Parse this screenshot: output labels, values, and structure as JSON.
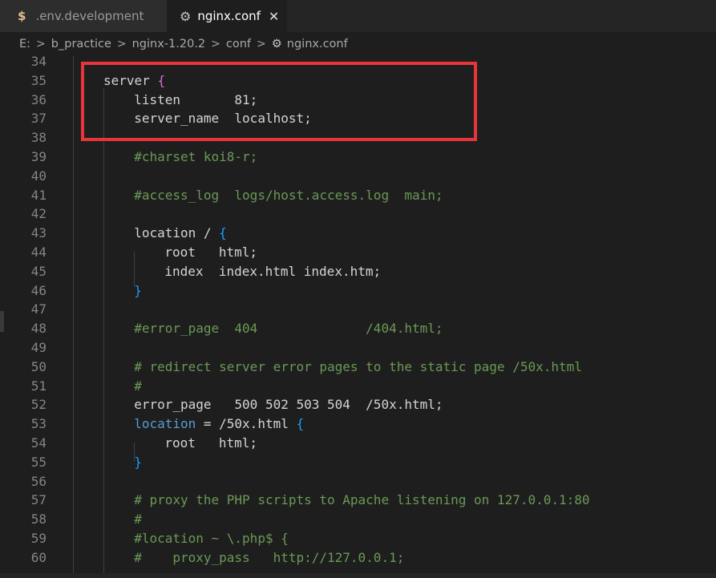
{
  "tabs": [
    {
      "label": ".env.development",
      "icon": "$",
      "active": false
    },
    {
      "label": "nginx.conf",
      "icon": "⚙",
      "active": true,
      "close": "✕"
    }
  ],
  "breadcrumb": [
    "E:",
    "b_practice",
    "nginx-1.20.2",
    "conf",
    "nginx.conf"
  ],
  "lines": [
    {
      "n": "34",
      "indent": 0,
      "tokens": []
    },
    {
      "n": "35",
      "indent": 1,
      "tokens": [
        {
          "t": "server ",
          "c": "text"
        },
        {
          "t": "{",
          "c": "bracket1"
        }
      ]
    },
    {
      "n": "36",
      "indent": 2,
      "tokens": [
        {
          "t": "listen       81;",
          "c": "text"
        }
      ]
    },
    {
      "n": "37",
      "indent": 2,
      "tokens": [
        {
          "t": "server_name  localhost;",
          "c": "text"
        }
      ]
    },
    {
      "n": "38",
      "indent": 0,
      "tokens": []
    },
    {
      "n": "39",
      "indent": 2,
      "tokens": [
        {
          "t": "#charset koi8-r;",
          "c": "comment"
        }
      ]
    },
    {
      "n": "40",
      "indent": 0,
      "tokens": []
    },
    {
      "n": "41",
      "indent": 2,
      "tokens": [
        {
          "t": "#access_log  logs/host.access.log  main;",
          "c": "comment"
        }
      ]
    },
    {
      "n": "42",
      "indent": 0,
      "tokens": []
    },
    {
      "n": "43",
      "indent": 2,
      "tokens": [
        {
          "t": "location / ",
          "c": "text"
        },
        {
          "t": "{",
          "c": "bracket2"
        }
      ]
    },
    {
      "n": "44",
      "indent": 3,
      "tokens": [
        {
          "t": "root   html;",
          "c": "text"
        }
      ]
    },
    {
      "n": "45",
      "indent": 3,
      "tokens": [
        {
          "t": "index  index.html index.htm;",
          "c": "text"
        }
      ]
    },
    {
      "n": "46",
      "indent": 2,
      "tokens": [
        {
          "t": "}",
          "c": "bracket2"
        }
      ]
    },
    {
      "n": "47",
      "indent": 0,
      "tokens": []
    },
    {
      "n": "48",
      "indent": 2,
      "tokens": [
        {
          "t": "#error_page  404              /404.html;",
          "c": "comment"
        }
      ]
    },
    {
      "n": "49",
      "indent": 0,
      "tokens": []
    },
    {
      "n": "50",
      "indent": 2,
      "tokens": [
        {
          "t": "# redirect server error pages to the static page /50x.html",
          "c": "comment"
        }
      ]
    },
    {
      "n": "51",
      "indent": 2,
      "tokens": [
        {
          "t": "#",
          "c": "comment"
        }
      ]
    },
    {
      "n": "52",
      "indent": 2,
      "tokens": [
        {
          "t": "error_page   500 502 503 504  /50x.html;",
          "c": "text"
        }
      ]
    },
    {
      "n": "53",
      "indent": 2,
      "tokens": [
        {
          "t": "location",
          "c": "keyword"
        },
        {
          "t": " = /50x.html ",
          "c": "text"
        },
        {
          "t": "{",
          "c": "bracket2"
        }
      ]
    },
    {
      "n": "54",
      "indent": 3,
      "tokens": [
        {
          "t": "root   html;",
          "c": "text"
        }
      ]
    },
    {
      "n": "55",
      "indent": 2,
      "tokens": [
        {
          "t": "}",
          "c": "bracket2"
        }
      ]
    },
    {
      "n": "56",
      "indent": 0,
      "tokens": []
    },
    {
      "n": "57",
      "indent": 2,
      "tokens": [
        {
          "t": "# proxy the PHP scripts to Apache listening on 127.0.0.1:80",
          "c": "comment"
        }
      ]
    },
    {
      "n": "58",
      "indent": 2,
      "tokens": [
        {
          "t": "#",
          "c": "comment"
        }
      ]
    },
    {
      "n": "59",
      "indent": 2,
      "tokens": [
        {
          "t": "#location ~ \\.php$ {",
          "c": "comment"
        }
      ]
    },
    {
      "n": "60",
      "indent": 2,
      "tokens": [
        {
          "t": "#    proxy_pass   http://127.0.0.1;",
          "c": "comment"
        }
      ]
    }
  ],
  "colors": {
    "background": "#1e1e1e",
    "comment": "#6a9955",
    "keyword": "#569cd6",
    "bracket1": "#da70d6",
    "bracket2": "#179fff",
    "highlight_box": "#e8343a"
  }
}
